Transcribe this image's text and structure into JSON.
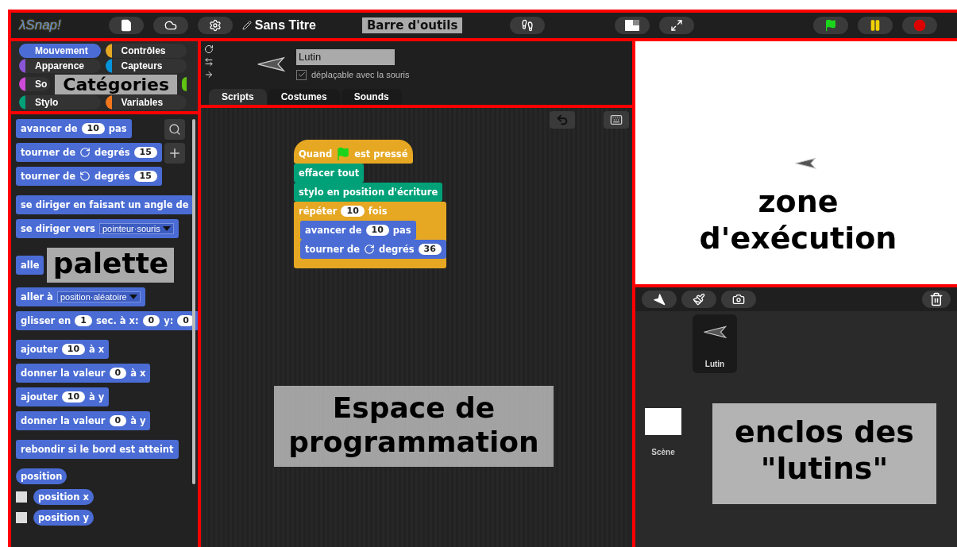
{
  "toolbar": {
    "logo": "λSnap!",
    "project_title": "Sans Titre",
    "annotation": "Barre d'outils"
  },
  "categories": {
    "annotation": "Catégories",
    "items": [
      {
        "label": "Mouvement",
        "color": "#4a6cd4",
        "selected": true
      },
      {
        "label": "Contrôles",
        "color": "#e6a822",
        "selected": false
      },
      {
        "label": "Apparence",
        "color": "#8a55d7",
        "selected": false
      },
      {
        "label": "Capteurs",
        "color": "#0494dc",
        "selected": false
      },
      {
        "label": "So",
        "color": "#cf4ad9",
        "selected": false
      },
      {
        "color": "#62c213",
        "selected": false
      },
      {
        "label": "Stylo",
        "color": "#00a178",
        "selected": false
      },
      {
        "label": "Variables",
        "color": "#f3761d",
        "selected": false
      }
    ]
  },
  "sprite": {
    "name": "Lutin",
    "draggable": true,
    "draggable_label": "déplaçable avec la souris",
    "tabs": [
      {
        "label": "Scripts",
        "selected": true
      },
      {
        "label": "Costumes",
        "selected": false
      },
      {
        "label": "Sounds",
        "selected": false
      }
    ]
  },
  "palette": {
    "annotation": "palette",
    "groups": [
      [
        {
          "kind": "command",
          "parts": [
            {
              "kind": "text",
              "text": "avancer de"
            },
            {
              "kind": "input",
              "text": "10"
            },
            {
              "kind": "text",
              "text": "pas"
            }
          ]
        },
        {
          "kind": "command",
          "parts": [
            {
              "kind": "text",
              "text": "tourner de"
            },
            {
              "kind": "rotate_cw"
            },
            {
              "kind": "text",
              "text": "degrés"
            },
            {
              "kind": "input",
              "text": "15"
            }
          ]
        },
        {
          "kind": "command",
          "parts": [
            {
              "kind": "text",
              "text": "tourner de"
            },
            {
              "kind": "rotate_ccw"
            },
            {
              "kind": "text",
              "text": "degrés"
            },
            {
              "kind": "input",
              "text": "15"
            }
          ]
        }
      ],
      [
        {
          "kind": "command",
          "parts": [
            {
              "kind": "text",
              "text": "se diriger en faisant un angle de"
            }
          ]
        },
        {
          "kind": "command",
          "parts": [
            {
              "kind": "text",
              "text": "se diriger vers"
            },
            {
              "kind": "dropdown",
              "text": "pointeur·souris"
            }
          ]
        }
      ],
      [
        {
          "kind": "command",
          "parts": [
            {
              "kind": "text",
              "text": "alle"
            }
          ]
        },
        {
          "kind": "command",
          "parts": [
            {
              "kind": "text",
              "text": "aller à"
            },
            {
              "kind": "dropdown",
              "text": "position·aléatoire"
            }
          ]
        },
        {
          "kind": "command",
          "parts": [
            {
              "kind": "text",
              "text": "glisser en"
            },
            {
              "kind": "input",
              "text": "1"
            },
            {
              "kind": "text",
              "text": "sec. à x:"
            },
            {
              "kind": "input",
              "text": "0"
            },
            {
              "kind": "text",
              "text": "y:"
            },
            {
              "kind": "input",
              "text": "0"
            }
          ]
        }
      ],
      [
        {
          "kind": "command",
          "parts": [
            {
              "kind": "text",
              "text": "ajouter"
            },
            {
              "kind": "input",
              "text": "10"
            },
            {
              "kind": "text",
              "text": "à x"
            }
          ]
        },
        {
          "kind": "command",
          "parts": [
            {
              "kind": "text",
              "text": "donner la valeur"
            },
            {
              "kind": "input",
              "text": "0"
            },
            {
              "kind": "text",
              "text": "à x"
            }
          ]
        },
        {
          "kind": "command",
          "parts": [
            {
              "kind": "text",
              "text": "ajouter"
            },
            {
              "kind": "input",
              "text": "10"
            },
            {
              "kind": "text",
              "text": "à y"
            }
          ]
        },
        {
          "kind": "command",
          "parts": [
            {
              "kind": "text",
              "text": "donner la valeur"
            },
            {
              "kind": "input",
              "text": "0"
            },
            {
              "kind": "text",
              "text": "à y"
            }
          ]
        }
      ],
      [
        {
          "kind": "command",
          "parts": [
            {
              "kind": "text",
              "text": "rebondir si le bord est atteint"
            }
          ]
        }
      ],
      [
        {
          "kind": "reporter",
          "parts": [
            {
              "kind": "text",
              "text": "position"
            }
          ]
        },
        {
          "kind": "reporter",
          "checked": false,
          "parts": [
            {
              "kind": "text",
              "text": "position x"
            }
          ]
        },
        {
          "kind": "reporter",
          "checked": false,
          "parts": [
            {
              "kind": "text",
              "text": "position y"
            }
          ]
        }
      ]
    ]
  },
  "scripts": {
    "annotation": "Espace de programmation",
    "script": [
      {
        "kind": "hat",
        "color": "#e6a822",
        "parts": [
          {
            "kind": "text",
            "text": "Quand"
          },
          {
            "kind": "flag"
          },
          {
            "kind": "text",
            "text": "est pressé"
          }
        ]
      },
      {
        "kind": "command",
        "color": "#00a178",
        "parts": [
          {
            "kind": "text",
            "text": "effacer tout"
          }
        ]
      },
      {
        "kind": "command",
        "color": "#00a178",
        "parts": [
          {
            "kind": "text",
            "text": "stylo en position d'écriture"
          }
        ]
      },
      {
        "kind": "c_block",
        "color": "#e6a822",
        "parts": [
          {
            "kind": "text",
            "text": "répéter"
          },
          {
            "kind": "input",
            "text": "10"
          },
          {
            "kind": "text",
            "text": "fois"
          }
        ],
        "children": [
          {
            "kind": "command",
            "color": "#4a6cd4",
            "parts": [
              {
                "kind": "text",
                "text": "avancer de"
              },
              {
                "kind": "input",
                "text": "10"
              },
              {
                "kind": "text",
                "text": "pas"
              }
            ]
          },
          {
            "kind": "command",
            "color": "#4a6cd4",
            "parts": [
              {
                "kind": "text",
                "text": "tourner de"
              },
              {
                "kind": "rotate_cw"
              },
              {
                "kind": "text",
                "text": "degrés"
              },
              {
                "kind": "input",
                "text": "36"
              }
            ]
          }
        ]
      }
    ]
  },
  "stage": {
    "annotation": "zone d'exécution"
  },
  "corral": {
    "annotation": "enclos des \"lutins\"",
    "sprites": [
      {
        "name": "Lutin",
        "selected": true
      }
    ],
    "stage_label": "Scène"
  }
}
